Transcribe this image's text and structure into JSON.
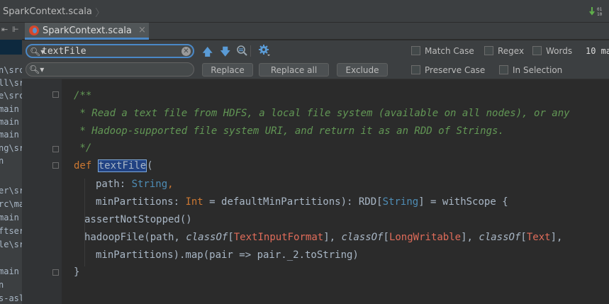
{
  "breadcrumb": {
    "file": "SparkContext.scala",
    "separator": "〉"
  },
  "left_panel": {
    "items": [
      "n\\src",
      "ll\\src",
      "e\\src",
      "main",
      "main",
      "main",
      "ng\\src",
      "n",
      "",
      "er\\src",
      "rc\\ma",
      "main",
      "ftser",
      "le\\src",
      "",
      "main",
      "n",
      "s-asl"
    ]
  },
  "tab": {
    "label": "SparkContext.scala",
    "close": "×"
  },
  "find": {
    "search_value": "textFile",
    "replace_value": "",
    "buttons": {
      "replace": "Replace",
      "replace_all": "Replace all",
      "exclude": "Exclude"
    },
    "options": {
      "match_case": "Match Case",
      "regex": "Regex",
      "words": "Words",
      "preserve_case": "Preserve Case",
      "in_selection": "In Selection"
    },
    "matches": "10 ma"
  },
  "code": {
    "l1": "/**",
    "l2": " * Read a text file from HDFS, a local file system (available on all nodes), or any",
    "l3": " * Hadoop-supported file system URI, and return it as an RDD of Strings.",
    "l4": " */",
    "l5_kw": "def",
    "l5_name": "textFile",
    "l5_paren": "(",
    "l6_param": "path: ",
    "l6_type": "String",
    "l6_end": ",",
    "l7_param": "minPartitions: ",
    "l7_type": "Int",
    "l7_mid": " = defaultMinPartitions): RDD[",
    "l7_type2": "String",
    "l7_end": "] = withScope {",
    "l8": "assertNotStopped()",
    "l9_a": "hadoopFile(path, ",
    "l9_classof1": "classOf",
    "l9_b": "[",
    "l9_t1": "TextInputFormat",
    "l9_c": "], ",
    "l9_classof2": "classOf",
    "l9_d": "[",
    "l9_t2": "LongWritable",
    "l9_e": "], ",
    "l9_classof3": "classOf",
    "l9_f": "[",
    "l9_t3": "Text",
    "l9_g": "],",
    "l10": "minPartitions).map(pair => pair._2.toString)",
    "l11": "}"
  },
  "colors": {
    "accent": "#4a88c7",
    "comment": "#629755",
    "keyword": "#cc7832",
    "type": "#4e8db6",
    "error_type": "#e06c5a"
  }
}
